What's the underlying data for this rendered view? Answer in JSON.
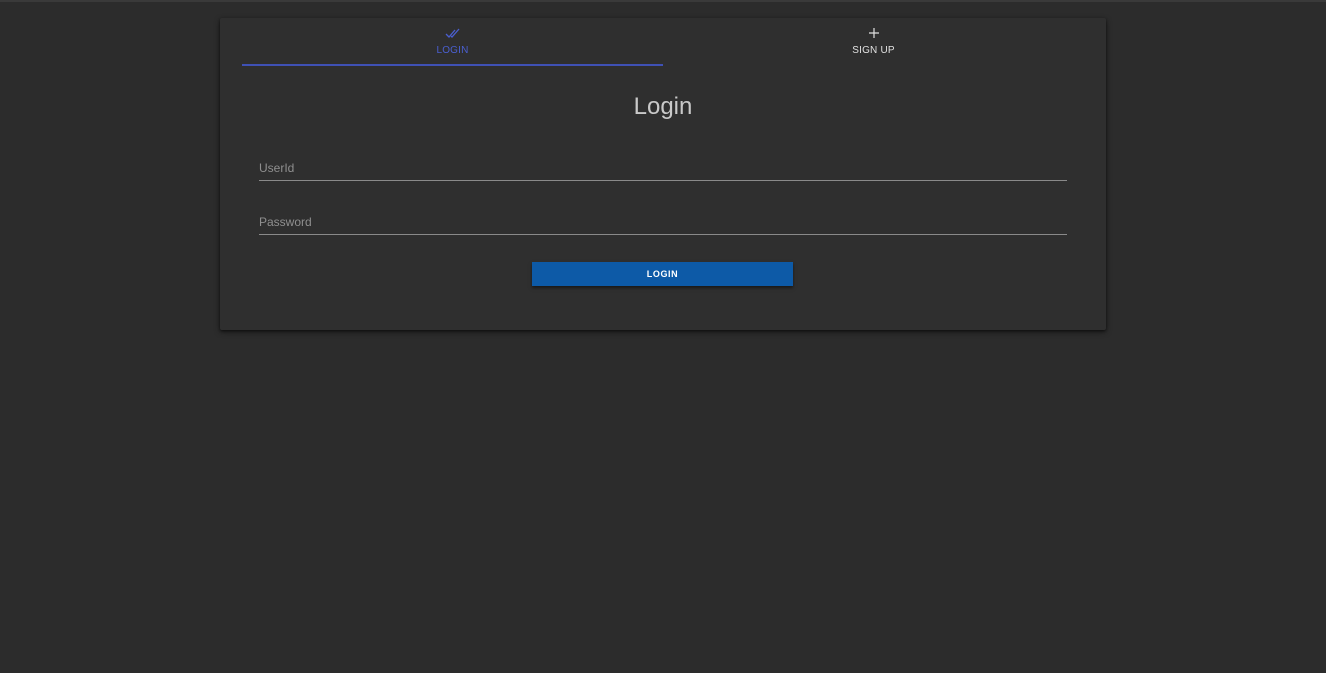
{
  "tabs": [
    {
      "label": "LOGIN",
      "icon": "double-check-icon",
      "active": true
    },
    {
      "label": "SIGN UP",
      "icon": "plus-icon",
      "active": false
    }
  ],
  "form": {
    "title": "Login",
    "userid": {
      "placeholder": "UserId",
      "value": ""
    },
    "password": {
      "placeholder": "Password",
      "value": ""
    },
    "submit_label": "LOGIN"
  },
  "colors": {
    "background": "#2c2c2c",
    "card": "#2f2f2f",
    "accent": "#3f51b5",
    "button": "#0d5aa7"
  }
}
